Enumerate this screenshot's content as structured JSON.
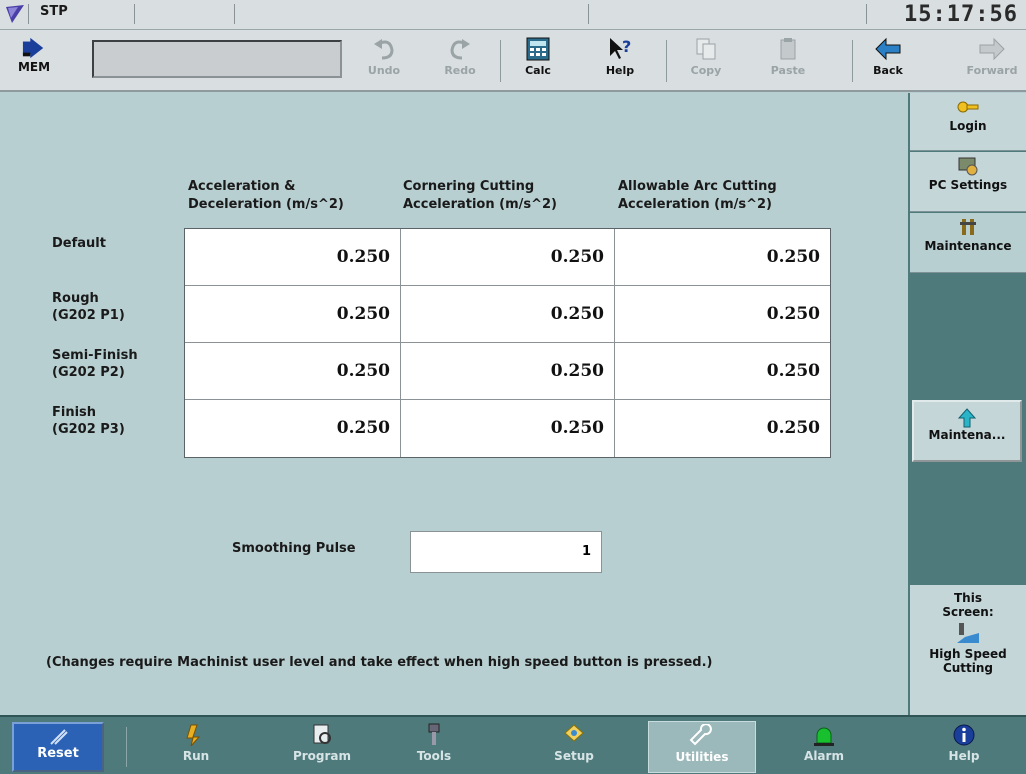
{
  "status": {
    "mode": "STP",
    "clock": "15:17:56"
  },
  "toolbar": {
    "mem": "MEM",
    "undo": "Undo",
    "redo": "Redo",
    "calc": "Calc",
    "help": "Help",
    "copy": "Copy",
    "paste": "Paste",
    "back": "Back",
    "forward": "Forward"
  },
  "table": {
    "headers": [
      [
        "Acceleration &",
        "Deceleration (m/s^2)"
      ],
      [
        "Cornering Cutting",
        "Acceleration (m/s^2)"
      ],
      [
        "Allowable Arc Cutting",
        "Acceleration (m/s^2)"
      ]
    ],
    "rows": [
      {
        "label": [
          "Default",
          ""
        ],
        "values": [
          "0.250",
          "0.250",
          "0.250"
        ]
      },
      {
        "label": [
          "Rough",
          "(G202 P1)"
        ],
        "values": [
          "0.250",
          "0.250",
          "0.250"
        ]
      },
      {
        "label": [
          "Semi-Finish",
          "(G202 P2)"
        ],
        "values": [
          "0.250",
          "0.250",
          "0.250"
        ]
      },
      {
        "label": [
          "Finish",
          "(G202 P3)"
        ],
        "values": [
          "0.250",
          "0.250",
          "0.250"
        ]
      }
    ]
  },
  "smoothing": {
    "label": "Smoothing Pulse",
    "value": "1"
  },
  "note": "(Changes require Machinist user level and take effect when high speed button is pressed.)",
  "right_panel": {
    "login": "Login",
    "pc_settings": "PC Settings",
    "maintenance": "Maintenance",
    "maint_button": "Maintena...",
    "this_screen_1": "This",
    "this_screen_2": "Screen:",
    "screen_name_1": "High Speed",
    "screen_name_2": "Cutting"
  },
  "nav": {
    "reset": "Reset",
    "run": "Run",
    "program": "Program",
    "tools": "Tools",
    "setup": "Setup",
    "utilities": "Utilities",
    "alarm": "Alarm",
    "help": "Help"
  },
  "colors": {
    "background": "#b8cfd1",
    "panel": "#4f7a7c",
    "reset": "#2b62b5"
  }
}
